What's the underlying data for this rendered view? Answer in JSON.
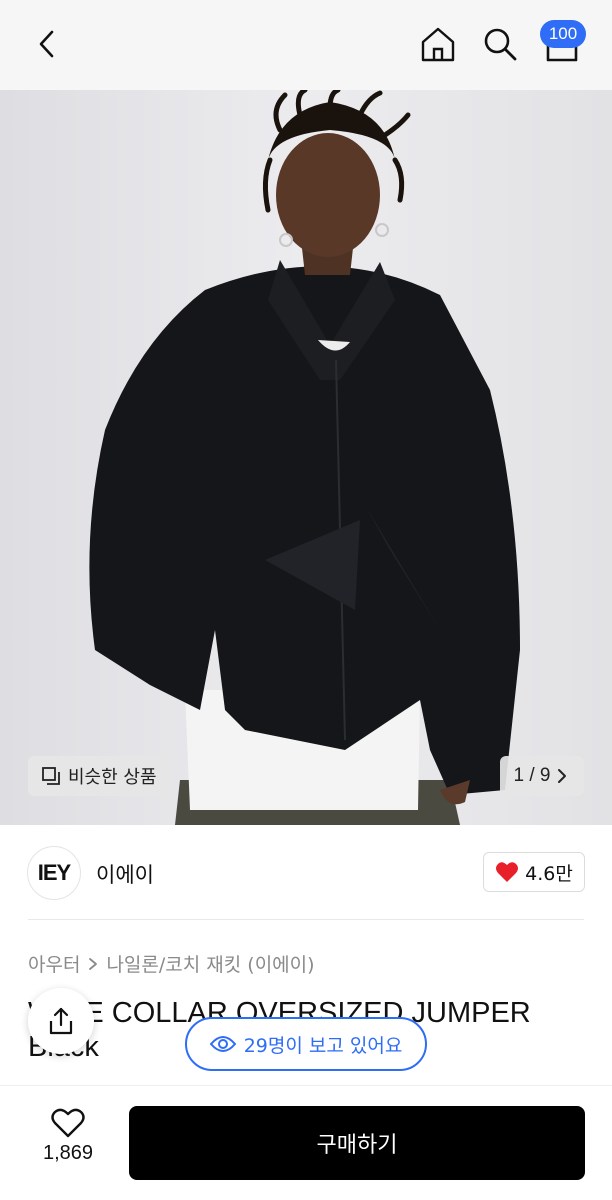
{
  "header": {
    "icons": {
      "back": "chevron-left-icon",
      "home": "home-icon",
      "search": "search-icon",
      "cart": "cart-icon"
    },
    "cart_badge": "100",
    "badge_color": "#2f6df6"
  },
  "gallery": {
    "similar_label": "비슷한 상품",
    "counter": "1 / 9"
  },
  "brand": {
    "logo_text": "IEY",
    "name": "이에이",
    "likes": "4.6만",
    "heart_color": "#e8202a"
  },
  "product": {
    "breadcrumb": [
      "아우터",
      "나일론/코치 재킷 (이에이)"
    ],
    "title": "WIDE COLLAR OVERSIZED JUMPER Black"
  },
  "viewers_label": "29명이 보고 있어요",
  "bottom": {
    "wish_count": "1,869",
    "buy_label": "구매하기"
  }
}
